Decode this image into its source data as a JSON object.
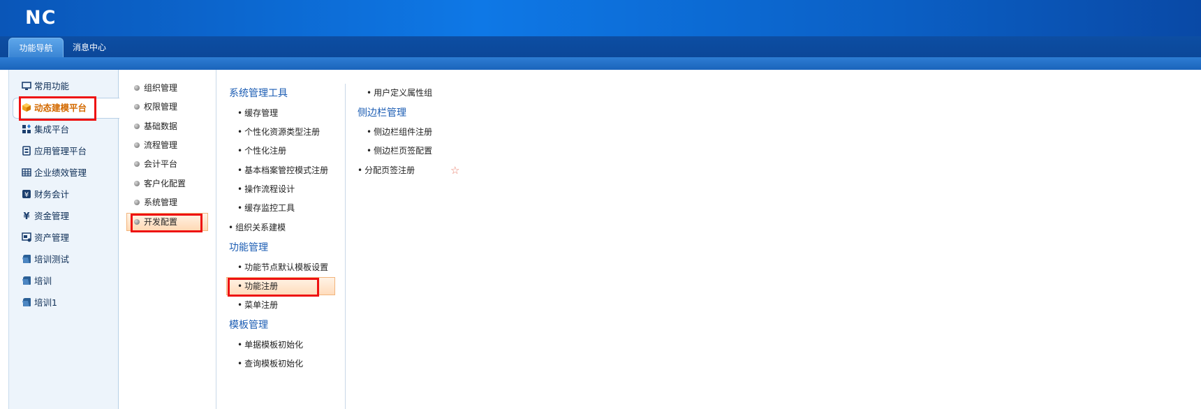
{
  "header": {
    "logo": "NC"
  },
  "tabs": [
    {
      "label": "功能导航",
      "active": true
    },
    {
      "label": "消息中心",
      "active": false
    }
  ],
  "left_nav": {
    "items": [
      {
        "label": "常用功能",
        "icon": "monitor-icon"
      },
      {
        "label": "动态建模平台",
        "icon": "cube-icon",
        "selected": true
      },
      {
        "label": "集成平台",
        "icon": "grid-icon"
      },
      {
        "label": "应用管理平台",
        "icon": "app-icon"
      },
      {
        "label": "企业绩效管理",
        "icon": "table-icon"
      },
      {
        "label": "财务会计",
        "icon": "yen-box-icon"
      },
      {
        "label": "资金管理",
        "icon": "yen-icon"
      },
      {
        "label": "资产管理",
        "icon": "asset-icon"
      },
      {
        "label": "培训测试",
        "icon": "folder-icon"
      },
      {
        "label": "培训",
        "icon": "folder-icon"
      },
      {
        "label": "培训1",
        "icon": "folder-icon"
      }
    ]
  },
  "mid_nav": {
    "items": [
      {
        "label": "组织管理"
      },
      {
        "label": "权限管理"
      },
      {
        "label": "基础数据"
      },
      {
        "label": "流程管理"
      },
      {
        "label": "会计平台"
      },
      {
        "label": "客户化配置"
      },
      {
        "label": "系统管理"
      },
      {
        "label": "开发配置",
        "selected": true
      }
    ]
  },
  "content": {
    "col1": {
      "sections": [
        {
          "title": "系统管理工具",
          "links": [
            "缓存管理",
            "个性化资源类型注册",
            "个性化注册",
            "基本档案管控模式注册",
            "操作流程设计",
            "缓存监控工具"
          ]
        },
        {
          "standalone": "组织关系建模"
        },
        {
          "title": "功能管理",
          "links": [
            "功能节点默认模板设置",
            "功能注册",
            "菜单注册"
          ]
        },
        {
          "title": "模板管理",
          "links": [
            "单据模板初始化",
            "查询模板初始化"
          ]
        }
      ]
    },
    "col2": {
      "top_link": "用户定义属性组",
      "section_title": "侧边栏管理",
      "links": [
        "侧边栏组件注册",
        "侧边栏页签配置"
      ],
      "standalone": "分配页签注册"
    }
  },
  "colors": {
    "header_blue": "#0e78e6",
    "highlight_orange": "#d36a00",
    "annotation_red": "#ee1111",
    "section_title_blue": "#1b5cb3"
  }
}
